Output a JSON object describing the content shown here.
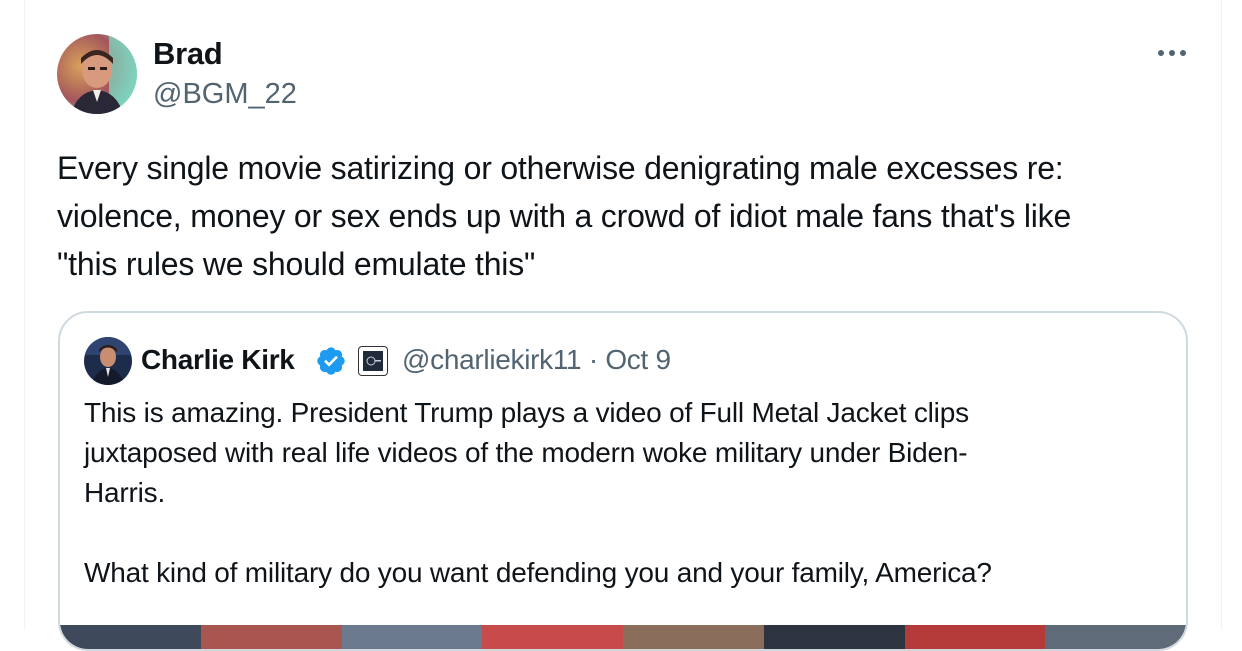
{
  "tweet": {
    "author_name": "Brad",
    "author_handle": "@BGM_22",
    "more_icon": "more-horizontal-icon",
    "text": "Every single movie satirizing or otherwise denigrating male excesses re:\nviolence, money or sex ends up with a crowd of idiot male fans that's like\n\"this rules we should emulate this\""
  },
  "quoted_tweet": {
    "author_name": "Charlie Kirk",
    "verified_icon": "verified-badge-icon",
    "affiliate_icon": "affiliate-badge-icon",
    "handle": "@charliekirk11",
    "separator": "·",
    "date": "Oct 9",
    "text": "This is amazing. President Trump plays a video of Full Metal Jacket clips\njuxtaposed with real life videos of the modern woke military under Biden-\nHarris.\n\nWhat kind of military do you want defending you and your family, America?"
  },
  "colors": {
    "text_primary": "#0f1419",
    "text_secondary": "#536471",
    "border": "#cfd9de",
    "verified_blue": "#1d9bf0"
  }
}
